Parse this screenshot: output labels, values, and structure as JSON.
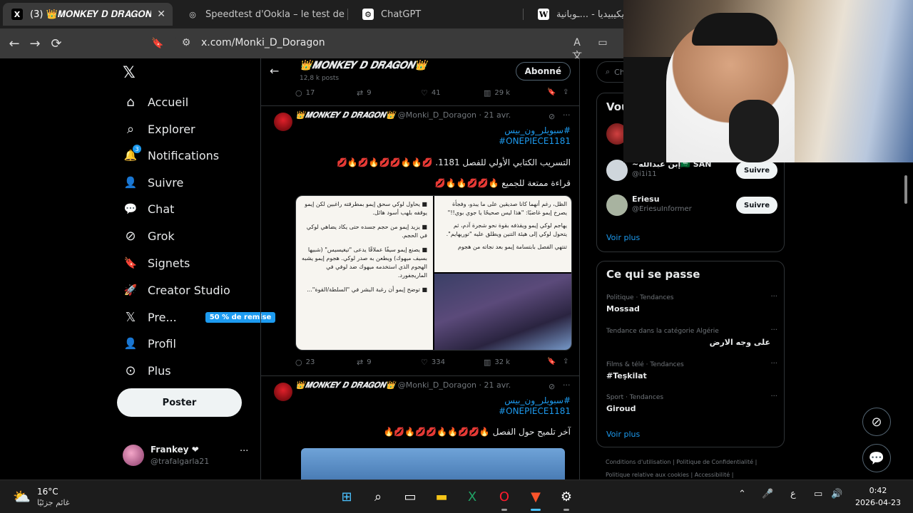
{
  "browser": {
    "tabs": [
      {
        "favicon": "X",
        "label": "(3) 👑𝑴𝑶𝑵𝑲𝑬𝒀 𝑫 𝑫𝑹𝑨𝑮𝑶𝑵",
        "active": true
      },
      {
        "favicon": "◎",
        "label": "Speedtest d'Ookla – le test de vitesse",
        "active": false
      },
      {
        "favicon": "⚙",
        "label": "ChatGPT",
        "active": false
      },
      {
        "favicon": "W",
        "label": "ويكيبيديا - ...ـوبانية",
        "active": false
      }
    ],
    "close_glyph": "✕",
    "back_glyph": "←",
    "forward_glyph": "→",
    "reload_glyph": "⟳",
    "bookmark_glyph": "🔖",
    "url": "x.com/Monki_D_Doragon"
  },
  "left_nav": {
    "logo": "𝕏",
    "notification_count": "3",
    "items": [
      {
        "icon": "home-icon",
        "glyph": "⌂",
        "label": "Accueil"
      },
      {
        "icon": "search-icon",
        "glyph": "⌕",
        "label": "Explorer"
      },
      {
        "icon": "bell-icon",
        "glyph": "🔔",
        "label": "Notifications"
      },
      {
        "icon": "add-user-icon",
        "glyph": "👤",
        "label": "Suivre"
      },
      {
        "icon": "chat-icon",
        "glyph": "💬",
        "label": "Chat"
      },
      {
        "icon": "grok-icon",
        "glyph": "⊘",
        "label": "Grok"
      },
      {
        "icon": "bookmark-icon",
        "glyph": "🔖",
        "label": "Signets"
      },
      {
        "icon": "rocket-icon",
        "glyph": "🚀",
        "label": "Creator Studio"
      },
      {
        "icon": "x-premium-icon",
        "glyph": "𝕏",
        "label": "Pre...",
        "promo": "50 % de remise"
      },
      {
        "icon": "profile-icon",
        "glyph": "👤",
        "label": "Profil"
      },
      {
        "icon": "more-icon",
        "glyph": "⊙",
        "label": "Plus"
      }
    ],
    "post_button": "Poster",
    "account": {
      "name": "Frankey ❤",
      "handle": "@trafalgarla21",
      "more": "···"
    }
  },
  "timeline": {
    "header": {
      "title": "👑𝑴𝑶𝑵𝑲𝑬𝒀 𝑫 𝑫𝑹𝑨𝑮𝑶𝑵👑",
      "subtitle": "12,8 k posts",
      "follow_button": "Abonné",
      "back_glyph": "←"
    },
    "top_actions": {
      "replies": "17",
      "reposts": "9",
      "likes": "41",
      "views": "29 k"
    },
    "tweets": [
      {
        "name": "👑𝑴𝑶𝑵𝑲𝑬𝒀 𝑫 𝑫𝑹𝑨𝑮𝑶𝑵👑",
        "handle": "@Monki_D_Doragon · 21 avr.",
        "hashtag_ar": "#سبويلر_ون_بيس",
        "hashtag": "#ONEPIECE1181",
        "line1": "التسريب الكتابي الأولي للفصل 1181. 💋🔥🔥💋💋🔥💋🔥💋",
        "line2": "قراءة ممتعة للجميع 🔥💋💋🔥🔥💋",
        "media_left": [
          "■ يحاول لوكي سحق إيمو بمطرقته راغبين لكن إيمو يوقفه بلهب أسود هائل.",
          "■ يزيد إيمو من حجم جسده حتى يكاد يضاهي لوكي في الحجم.",
          "■ يصنع إيمو سيفًا عملاقًا يدعى \"تيغيسيس\" (شبيها بسيف ميهوك) ويطعن به صدر لوكي. هجوم إيمو يشبه الهجوم الذي استخدمه ميهوك ضد لوفي في الماريجفورد.",
          "■ توضح إيمو أن رغبة البشر في \"السلطة/القوة\"..."
        ],
        "media_right": [
          "الظل، رغم أنهما كانا صديقين على ما يبدو، وفجأة يصرخ إيمو غاضبًا: \"هذا ليس صحيحًا يا جوي بوي!!\"",
          "يهاجم لوكي إيمو ويقذفه بقوة نحو شجرة آدم، ثم يتحول لوكي إلى هيئة التنين ويطلق عليه \"توريهايم\".",
          "تنتهي الفصل بابتسامة إيمو بعد نجاته من هجوم"
        ],
        "actions": {
          "replies": "23",
          "reposts": "9",
          "likes": "334",
          "views": "32 k"
        }
      },
      {
        "name": "👑𝑴𝑶𝑵𝑲𝑬𝒀 𝑫 𝑫𝑹𝑨𝑮𝑶𝑵👑",
        "handle": "@Monki_D_Doragon · 21 avr.",
        "hashtag_ar": "#سبويلر_ون_بيس",
        "hashtag": "#ONEPIECE1181",
        "line1": "آخر تلميح حول الفصل 🔥💋💋🔥🔥💋💋🔥💋🔥"
      }
    ]
  },
  "right": {
    "search_placeholder": "Ch...",
    "who_to_follow_title": "Vou...",
    "suggestions": [
      {
        "name": "~إبن عبدالله🇸🇦 SAN",
        "handle": "@i1i11",
        "button": "Suivre"
      },
      {
        "name": "Eriesu",
        "handle": "@EriesuInformer",
        "button": "Suivre"
      }
    ],
    "see_more": "Voir plus",
    "trends_title": "Ce qui se passe",
    "trends": [
      {
        "category": "Politique · Tendances",
        "title": "Mossad"
      },
      {
        "category": "Tendance dans la catégorie Algérie",
        "title": "على وجه الارض"
      },
      {
        "category": "Films & télé · Tendances",
        "title": "#Teşkilat"
      },
      {
        "category": "Sport · Tendances",
        "title": "Giroud"
      }
    ],
    "trends_see_more": "Voir plus",
    "footer1": "Conditions d'utilisation  |  Politique de Confidentialité  |",
    "footer2": "Politique relative aux cookies  |  Accessibilité  |"
  },
  "taskbar": {
    "temperature": "16°C",
    "weather_desc": "غائم جزئيًا",
    "lang": "ع",
    "time": "0:42",
    "date": "2026-04-23"
  },
  "colors": {
    "accent": "#1d9bf0",
    "background": "#000000",
    "text": "#e7e9ea",
    "muted": "#71767b"
  }
}
